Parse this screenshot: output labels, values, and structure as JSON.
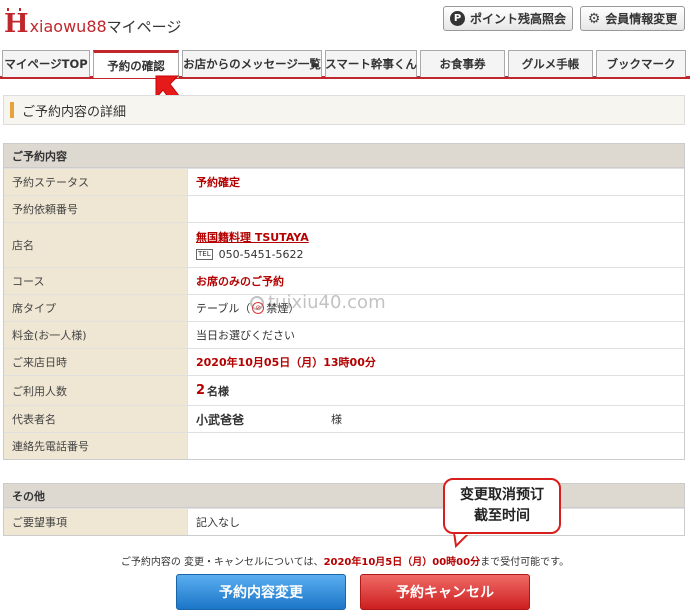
{
  "header": {
    "logo_letter": "H",
    "logo_text": "xiaowu88",
    "logo_suffix": "マイページ",
    "points_label": "ポイント残高照会",
    "points_icon": "P",
    "member_label": "会員情報変更"
  },
  "tabs": [
    {
      "label": "マイページTOP"
    },
    {
      "label": "予約の確認"
    },
    {
      "label": "お店からのメッセージ一覧"
    },
    {
      "label": "スマート幹事くん"
    },
    {
      "label": "お食事券"
    },
    {
      "label": "グルメ手帳"
    },
    {
      "label": "ブックマーク"
    }
  ],
  "page_title": "ご予約内容の詳細",
  "reservation": {
    "heading": "ご予約内容",
    "rows": [
      {
        "label": "予約ステータス",
        "value": "予約確定"
      },
      {
        "label": "予約依頼番号",
        "value": ""
      },
      {
        "label": "店名",
        "value": "無国籍料理 TSUTAYA",
        "tel_icon": "TEL",
        "tel": "050-5451-5622"
      },
      {
        "label": "コース",
        "value": "お席のみのご予約"
      },
      {
        "label": "席タイプ",
        "value_pre": "テーブル（",
        "value_post": "禁煙）"
      },
      {
        "label": "料金(お一人様)",
        "value": "当日お選びください"
      },
      {
        "label": "ご来店日時",
        "value": "2020年10月05日（月）13時00分"
      },
      {
        "label": "ご利用人数",
        "count": "2",
        "unit": "名様"
      },
      {
        "label": "代表者名",
        "name": "小武爸爸",
        "honorific": "様"
      },
      {
        "label": "連絡先電話番号",
        "value": ""
      }
    ]
  },
  "other": {
    "heading": "その他",
    "rows": [
      {
        "label": "ご要望事項",
        "value": "記入なし"
      }
    ]
  },
  "notice": {
    "pre": "ご予約内容の 変更・キャンセルについては、",
    "deadline": "2020年10月5日（月）00時00分",
    "post": "まで受付可能です。"
  },
  "buttons": {
    "change": "予約内容変更",
    "cancel": "予約キャンセル"
  },
  "watermark": "tuixiu40.com",
  "callout": {
    "line1": "变更取消预订",
    "line2": "截至时间"
  },
  "colors": {
    "accent": "#c0272d",
    "label_bg": "#efe7d4",
    "callout_border": "#d91e1e",
    "button_blue": "#1c76c8",
    "button_red": "#cc1f1f"
  }
}
